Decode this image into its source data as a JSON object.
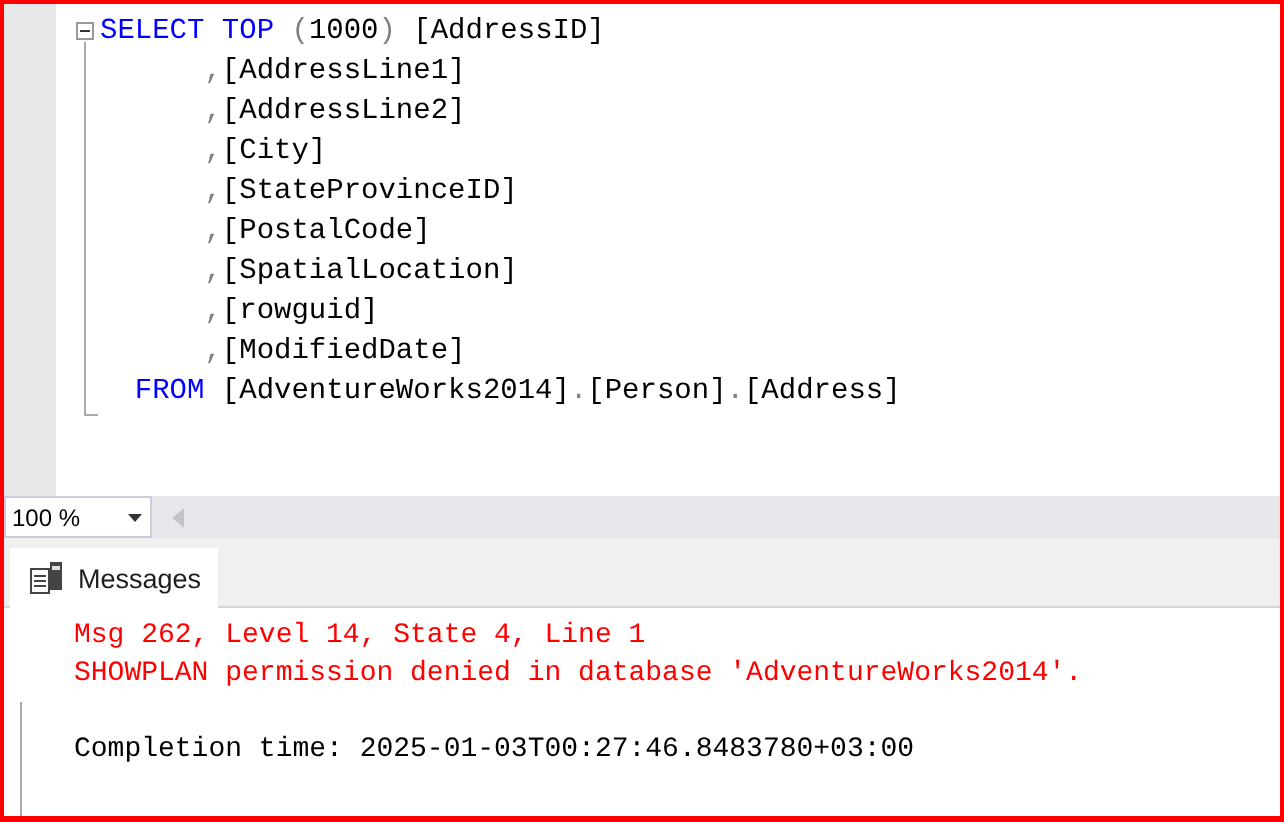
{
  "editor": {
    "collapsed": false,
    "lines": [
      [
        {
          "text": "SELECT",
          "kind": "keyword"
        },
        {
          "text": " TOP",
          "kind": "keyword"
        },
        {
          "text": " (",
          "kind": "punct"
        },
        {
          "text": "1000",
          "kind": "plain"
        },
        {
          "text": ")",
          "kind": "punct"
        },
        {
          "text": " [AddressID]",
          "kind": "plain"
        }
      ],
      [
        {
          "text": "      ,",
          "kind": "punct"
        },
        {
          "text": "[AddressLine1]",
          "kind": "plain"
        }
      ],
      [
        {
          "text": "      ,",
          "kind": "punct"
        },
        {
          "text": "[AddressLine2]",
          "kind": "plain"
        }
      ],
      [
        {
          "text": "      ,",
          "kind": "punct"
        },
        {
          "text": "[City]",
          "kind": "plain"
        }
      ],
      [
        {
          "text": "      ,",
          "kind": "punct"
        },
        {
          "text": "[StateProvinceID]",
          "kind": "plain"
        }
      ],
      [
        {
          "text": "      ,",
          "kind": "punct"
        },
        {
          "text": "[PostalCode]",
          "kind": "plain"
        }
      ],
      [
        {
          "text": "      ,",
          "kind": "punct"
        },
        {
          "text": "[SpatialLocation]",
          "kind": "plain"
        }
      ],
      [
        {
          "text": "      ,",
          "kind": "punct"
        },
        {
          "text": "[rowguid]",
          "kind": "plain"
        }
      ],
      [
        {
          "text": "      ,",
          "kind": "punct"
        },
        {
          "text": "[ModifiedDate]",
          "kind": "plain"
        }
      ],
      [
        {
          "text": "  FROM",
          "kind": "keyword"
        },
        {
          "text": " [AdventureWorks2014]",
          "kind": "plain"
        },
        {
          "text": ".",
          "kind": "punct"
        },
        {
          "text": "[Person]",
          "kind": "plain"
        },
        {
          "text": ".",
          "kind": "punct"
        },
        {
          "text": "[Address]",
          "kind": "plain"
        }
      ]
    ]
  },
  "zoom": {
    "value": "100 %"
  },
  "results": {
    "tabs": [
      {
        "label": "Messages",
        "selected": true
      }
    ],
    "messages": [
      {
        "text": "Msg 262, Level 14, State 4, Line 1",
        "kind": "error"
      },
      {
        "text": "SHOWPLAN permission denied in database 'AdventureWorks2014'.",
        "kind": "error"
      },
      {
        "text": "Completion time: 2025-01-03T00:27:46.8483780+03:00",
        "kind": "info"
      }
    ]
  }
}
